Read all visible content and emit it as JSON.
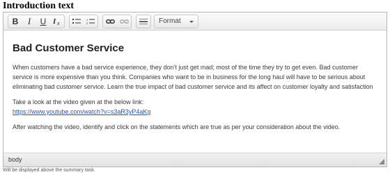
{
  "field": {
    "label": "Introduction text",
    "help": "Will be displayed above the summary task."
  },
  "toolbar": {
    "bold": "B",
    "italic": "I",
    "underline": "U",
    "clear_format": "Ix",
    "format_value": "Format",
    "icons": [
      "bold",
      "italic",
      "underline",
      "remove-format",
      "bulleted-list",
      "numbered-list",
      "link",
      "unlink",
      "horizontal-rule",
      "format-dropdown"
    ]
  },
  "content": {
    "heading": "Bad Customer Service",
    "paragraph1": "When customers have a bad service experience, they don't just get mad; most of the time they try to get even. Bad customer service is more expensive than you think. Companies who want to be in business for the long haul will have to be serious about eliminating bad customer service. Learn the true impact of bad customer service and its affect on customer loyalty and satisfaction",
    "paragraph2": "Take a look at the video given at the below link:",
    "link": "https://www.youtube.com/watch?v=s3aR3yP4aKg",
    "paragraph3": "After watching the video, identify and click on the statements which are true as per your consideration about the video."
  },
  "statusbar": {
    "path": "body"
  }
}
